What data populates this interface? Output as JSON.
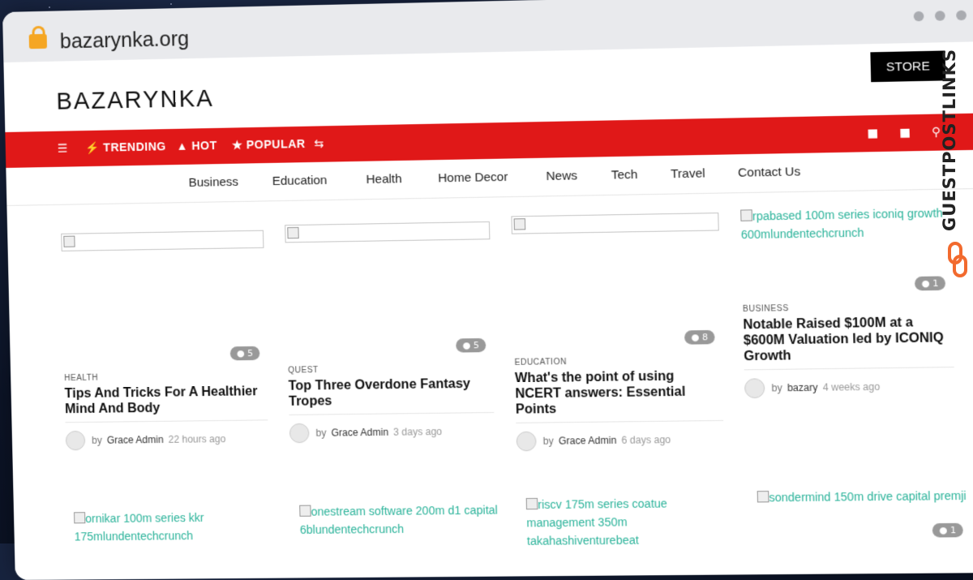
{
  "browser": {
    "url": "bazarynka.org"
  },
  "site": {
    "logo": "BAZARYNKA",
    "store_label": "STORE"
  },
  "topbar": {
    "links": [
      {
        "label": "TRENDING",
        "icon": "bolt-icon"
      },
      {
        "label": "HOT",
        "icon": "fire-icon"
      },
      {
        "label": "POPULAR",
        "icon": "star-icon"
      }
    ]
  },
  "nav": {
    "items": [
      "Business",
      "Education",
      "Health",
      "Home Decor",
      "News",
      "Tech",
      "Travel",
      "Contact Us"
    ]
  },
  "posts": [
    {
      "category": "HEALTH",
      "title": "Tips And Tricks For A Healthier Mind And Body",
      "comments": "5",
      "author": "Grace Admin",
      "time": "22 hours ago",
      "by": "by"
    },
    {
      "category": "QUEST",
      "title": "Top Three Overdone Fantasy Tropes",
      "comments": "5",
      "author": "Grace Admin",
      "time": "3 days ago",
      "by": "by"
    },
    {
      "category": "EDUCATION",
      "title": "What's the point of using NCERT answers: Essential Points",
      "comments": "8",
      "author": "Grace Admin",
      "time": "6 days ago",
      "by": "by"
    },
    {
      "category": "BUSINESS",
      "title": "Notable Raised $100M at a $600M Valuation led by ICONIQ Growth",
      "comments": "1",
      "author": "bazary",
      "time": "4 weeks ago",
      "by": "by",
      "image_alt": "rpabased 100m series iconiq growth 600mlundentechcrunch"
    }
  ],
  "second_row": [
    {
      "image_alt": "ornikar 100m series kkr 175mlundentechcrunch"
    },
    {
      "image_alt": "onestream software 200m d1 capital 6blundentechcrunch"
    },
    {
      "image_alt": "riscv 175m series coatue management 350m takahashiventurebeat"
    },
    {
      "image_alt": "sondermind 150m drive capital premji",
      "comments": "1"
    }
  ],
  "watermark": {
    "text": "GUESTPOSTLINKS"
  },
  "colors": {
    "accent_red": "#e01818",
    "link_teal": "#2bb39a",
    "store_bg": "#000000"
  }
}
